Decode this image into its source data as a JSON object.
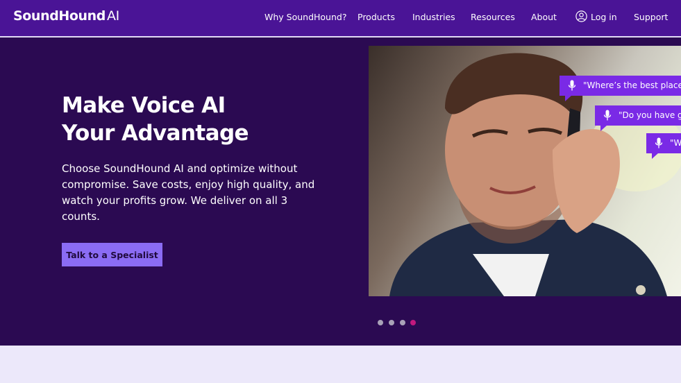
{
  "brand": {
    "name": "SoundHound",
    "suffix": "AI"
  },
  "nav": {
    "items": [
      "Why SoundHound?",
      "Products",
      "Industries",
      "Resources",
      "About"
    ],
    "login": "Log in",
    "support": "Support"
  },
  "hero": {
    "title": "Make Voice AI Your Advantage",
    "subtitle": "Choose SoundHound AI and optimize without compromise. Save costs, enjoy high quality, and watch your profits grow. We deliver on all 3 counts.",
    "cta": "Talk to a Specialist"
  },
  "bubbles": [
    "\"Where’s the best place to",
    "\"Do you have glu",
    "\"W"
  ],
  "carousel": {
    "count": 4,
    "active_index": 3
  },
  "colors": {
    "nav_bg": "#4a1496",
    "hero_bg": "#2b0a52",
    "cta_bg": "#8b6cf4",
    "bubble_bg": "#7a2ae6",
    "active_dot": "#c2197e"
  },
  "icons": {
    "login": "user-circle-icon",
    "bubble": "microphone-icon"
  }
}
